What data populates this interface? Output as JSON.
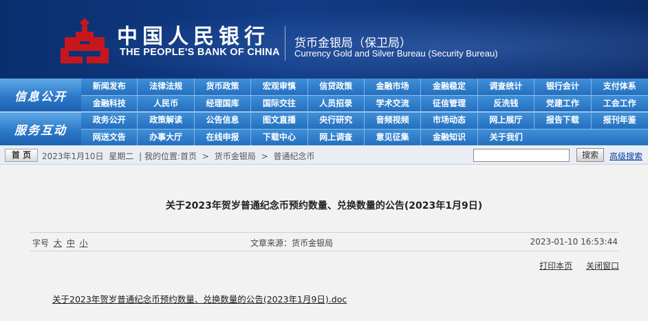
{
  "header": {
    "bank_name_cn": "中国人民银行",
    "bank_name_en": "THE PEOPLE'S BANK OF CHINA",
    "bureau_cn": "货币金银局（保卫局）",
    "bureau_en": "Currency  Gold and Silver Bureau (Security Bureau)",
    "colors": {
      "banner": "#113b86",
      "logo": "#c8161d"
    }
  },
  "nav": {
    "group1": {
      "label": "信息公开",
      "row1": [
        "新闻发布",
        "法律法规",
        "货币政策",
        "宏观审慎",
        "信贷政策",
        "金融市场",
        "金融稳定",
        "调查统计",
        "银行会计",
        "支付体系"
      ],
      "row2": [
        "金融科技",
        "人民币",
        "经理国库",
        "国际交往",
        "人员招录",
        "学术交流",
        "征信管理",
        "反洗钱",
        "党建工作",
        "工会工作"
      ]
    },
    "group2": {
      "label": "服务互动",
      "row1": [
        "政务公开",
        "政策解读",
        "公告信息",
        "图文直播",
        "央行研究",
        "音频视频",
        "市场动态",
        "网上展厅",
        "报告下载",
        "报刊年鉴"
      ],
      "row2": [
        "网送文告",
        "办事大厅",
        "在线申报",
        "下载中心",
        "网上调查",
        "意见征集",
        "金融知识",
        "关于我们"
      ]
    }
  },
  "breadcrumb": {
    "home_label": "首 页",
    "date": "2023年1月10日",
    "weekday": "星期二",
    "location_prefix": "| 我的位置:首页",
    "sep1": ">",
    "level1": "货币金银局",
    "sep2": ">",
    "level2": "普通纪念币"
  },
  "search": {
    "value": "",
    "button_label": "搜索",
    "advanced_label": "高级搜索"
  },
  "article": {
    "title": "关于2023年贺岁普通纪念币预约数量、兑换数量的公告(2023年1月9日)",
    "font_size_label": "字号",
    "font_large": "大",
    "font_medium": "中",
    "font_small": "小",
    "source": "文章来源：货币金银局",
    "datetime": "2023-01-10  16:53:44",
    "print_label": "打印本页",
    "close_label": "关闭窗口",
    "attachment": "关于2023年贺岁普通纪念币预约数量、兑换数量的公告(2023年1月9日).doc"
  }
}
